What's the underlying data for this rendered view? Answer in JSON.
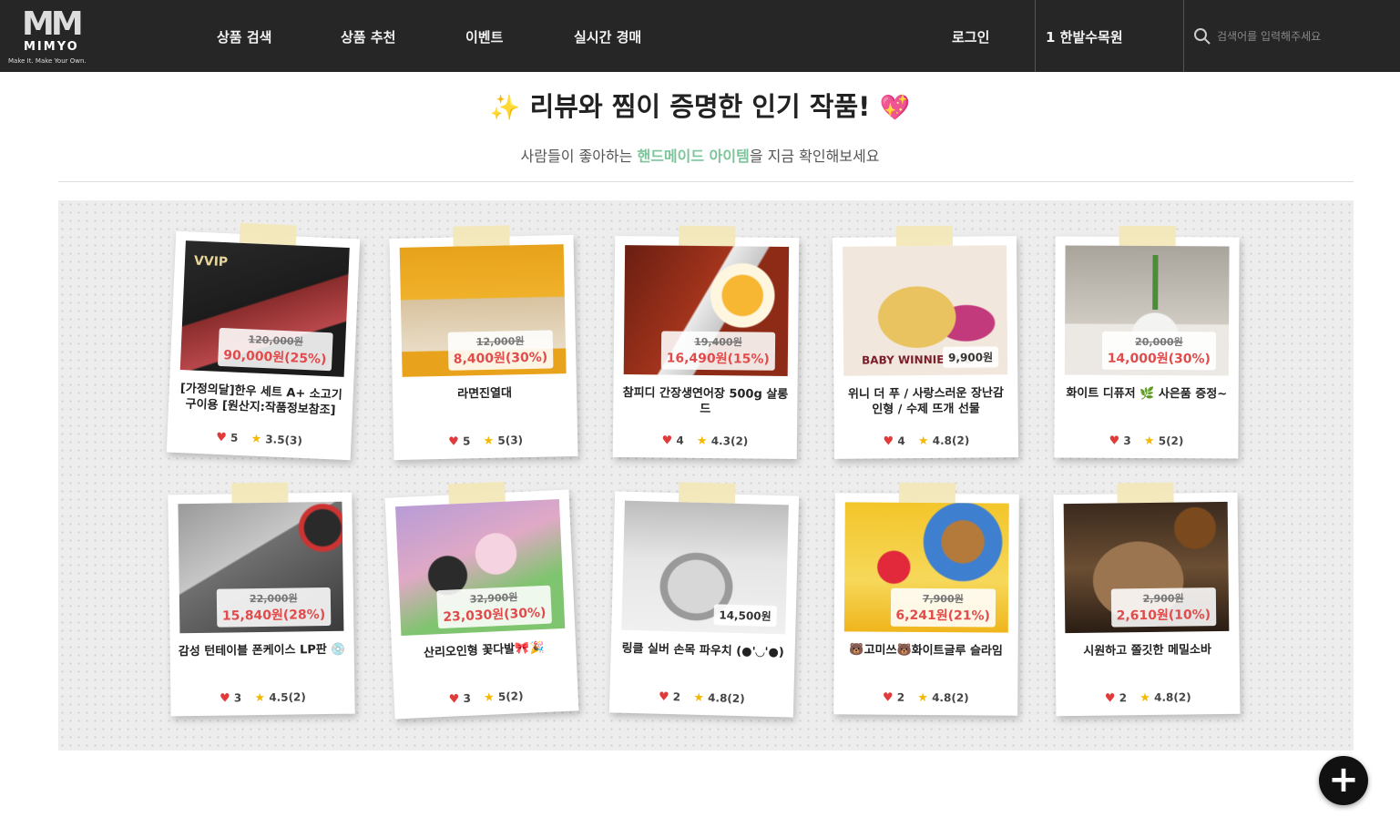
{
  "brand": {
    "mark": "MM",
    "name": "MIMYO",
    "tagline": "Make It.  Make Your Own."
  },
  "nav": {
    "items": [
      "상품 검색",
      "상품 추천",
      "이벤트",
      "실시간 경매"
    ],
    "login": "로그인",
    "user": "1 한밭수목원"
  },
  "search": {
    "placeholder": "검색어를 입력해주세요"
  },
  "section": {
    "title_prefix": "✨",
    "title": "리뷰와 찜이 증명한 인기 작품!",
    "title_suffix": "💖",
    "subtitle_before": "사람들이 좋아하는 ",
    "subtitle_highlight": "핸드메이드 아이템",
    "subtitle_after": "을 지금 확인해보세요"
  },
  "products": [
    {
      "title": "[가정의달]한우 세트 A+ 소고기 구이용 [원산지:작품정보참조]",
      "original_price": "120,000원",
      "sale_price": "90,000원(25%)",
      "likes": "5",
      "rating": "3.5(3)",
      "photo_text": "VVIP"
    },
    {
      "title": "라면진열대",
      "original_price": "12,000원",
      "sale_price": "8,400원(30%)",
      "likes": "5",
      "rating": "5(3)"
    },
    {
      "title": "참피디 간장생연어장 500g 살롱드",
      "original_price": "19,400원",
      "sale_price": "16,490원(15%)",
      "likes": "4",
      "rating": "4.3(2)"
    },
    {
      "title": "위니 더 푸 / 사랑스러운 장난감 인형 / 수제 뜨개 선물",
      "original_price": "",
      "sale_price": "9,900원",
      "likes": "4",
      "rating": "4.8(2)",
      "photo_text": "BABY WINNIE THE"
    },
    {
      "title": "화이트 디퓨저 🌿 사은품 증정~",
      "original_price": "20,000원",
      "sale_price": "14,000원(30%)",
      "likes": "3",
      "rating": "5(2)"
    },
    {
      "title": "감성 턴테이블 폰케이스 LP판 💿",
      "original_price": "22,000원",
      "sale_price": "15,840원(28%)",
      "likes": "3",
      "rating": "4.5(2)"
    },
    {
      "title": "산리오인형 꽃다발🎀🎉",
      "original_price": "32,900원",
      "sale_price": "23,030원(30%)",
      "likes": "3",
      "rating": "5(2)"
    },
    {
      "title": "링클 실버 손목 파우치 (●'◡'●)",
      "original_price": "",
      "sale_price": "14,500원",
      "likes": "2",
      "rating": "4.8(2)"
    },
    {
      "title": "🐻고미쓰🐻화이트글루 슬라임",
      "original_price": "7,900원",
      "sale_price": "6,241원(21%)",
      "likes": "2",
      "rating": "4.8(2)"
    },
    {
      "title": "시원하고 쫄깃한 메밀소바",
      "original_price": "2,900원",
      "sale_price": "2,610원(10%)",
      "likes": "2",
      "rating": "4.8(2)"
    }
  ],
  "fab": {
    "label": "+"
  },
  "colors": {
    "header_bg": "#262626",
    "accent_green": "#7cc59a",
    "sale_red": "#e24b4b",
    "tape": "#f3e7b9"
  }
}
